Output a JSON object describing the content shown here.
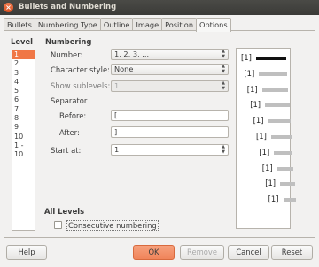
{
  "window": {
    "title": "Bullets and Numbering"
  },
  "tabs": [
    {
      "label": "Bullets"
    },
    {
      "label": "Numbering Type"
    },
    {
      "label": "Outline"
    },
    {
      "label": "Image"
    },
    {
      "label": "Position"
    },
    {
      "label": "Options"
    }
  ],
  "level": {
    "heading": "Level",
    "items": [
      "1",
      "2",
      "3",
      "4",
      "5",
      "6",
      "7",
      "8",
      "9",
      "10",
      "1 - 10"
    ],
    "selected": "1"
  },
  "numbering": {
    "heading": "Numbering",
    "number_label": "Number:",
    "number_value": "1, 2, 3, ...",
    "charstyle_label": "Character style:",
    "charstyle_value": "None",
    "sublevels_label": "Show sublevels:",
    "sublevels_value": "1",
    "separator_label": "Separator",
    "before_label": "Before:",
    "before_value": "[",
    "after_label": "After:",
    "after_value": "]",
    "startat_label": "Start at:",
    "startat_value": "1"
  },
  "preview": {
    "label": "[1]"
  },
  "all_levels": {
    "heading": "All Levels",
    "consecutive_label": "Consecutive numbering",
    "consecutive_checked": false
  },
  "buttons": {
    "help": "Help",
    "ok": "OK",
    "remove": "Remove",
    "cancel": "Cancel",
    "reset": "Reset"
  },
  "colors": {
    "accent": "#f07746",
    "titlebar": "#3c3b37"
  }
}
